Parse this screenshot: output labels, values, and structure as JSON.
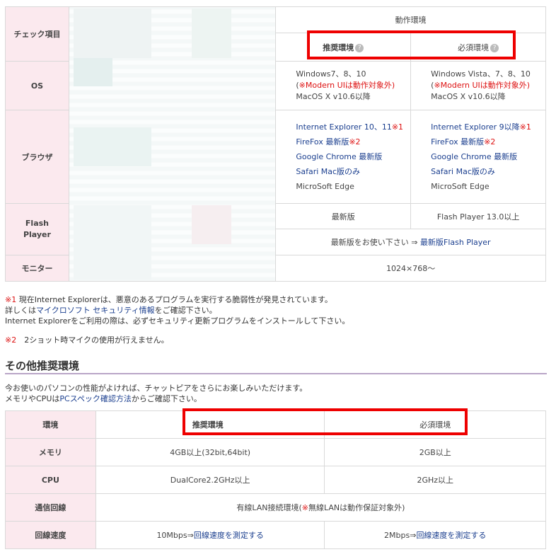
{
  "table1": {
    "header": {
      "check_item": "チェック項目",
      "env": "動作環境",
      "recommended": "推奨環境",
      "required": "必須環境",
      "help": "?"
    },
    "os": {
      "label": "OS",
      "rec": [
        "Windows7、8、10",
        "※Modern UIは動作対象外)",
        "MacOS X v10.6以降"
      ],
      "req": [
        "Windows Vista、7、8、10",
        "※Modern UIは動作対象外)",
        "MacOS X v10.6以降"
      ]
    },
    "browser": {
      "label": "ブラウザ",
      "rec": [
        {
          "text": "Internet Explorer 10、11",
          "mark": "※1"
        },
        {
          "text": "FireFox 最新版",
          "mark": "※2"
        },
        {
          "text": "Google Chrome 最新版",
          "mark": ""
        },
        {
          "text": "Safari Mac版のみ",
          "mark": ""
        },
        {
          "text": "MicroSoft Edge",
          "mark": ""
        }
      ],
      "req": [
        {
          "text": "Internet Explorer 9以降",
          "mark": "※1"
        },
        {
          "text": "FireFox 最新版",
          "mark": "※2"
        },
        {
          "text": "Google Chrome 最新版",
          "mark": ""
        },
        {
          "text": "Safari Mac版のみ",
          "mark": ""
        },
        {
          "text": "MicroSoft Edge",
          "mark": ""
        }
      ]
    },
    "flash": {
      "label_1": "Flash",
      "label_2": "Player",
      "rec": "最新版",
      "req": "Flash Player 13.0以上",
      "note_prefix": "最新版をお使い下さい ⇒ ",
      "note_link": "最新版Flash Player"
    },
    "monitor": {
      "label": "モニター",
      "value": "1024×768〜"
    }
  },
  "notes": {
    "n1_mark": "※1",
    "n1_line1": " 現在Internet Explorerは、悪意のあるプログラムを実行する脆弱性が発見されています。",
    "n1_line2_prefix": "詳しくは",
    "n1_line2_link": "マイクロソフト セキュリティ情報",
    "n1_line2_suffix": "をご確認下さい。",
    "n1_line3": "Internet Explorerをご利用の際は、必ずセキュリティ更新プログラムをインストールして下さい。",
    "n2_mark": "※2",
    "n2_text": "　2ショット時マイクの使用が行えません。"
  },
  "section2": {
    "title": "その他推奨環境",
    "desc1": "今お使いのパソコンの性能がよければ、チャットピアをさらにお楽しみいただけます。",
    "desc2_prefix": "メモリやCPUは",
    "desc2_link": "PCスペック確認方法",
    "desc2_suffix": "からご確認下さい。"
  },
  "table2": {
    "env_label": "環境",
    "recommended": "推奨環境",
    "required": "必須環境",
    "memory": {
      "label": "メモリ",
      "rec": "4GB以上(32bit,64bit)",
      "req": "2GB以上"
    },
    "cpu": {
      "label": "CPU",
      "rec": "DualCore2.2GHz以上",
      "req": "2GHz以上"
    },
    "line": {
      "label": "通信回線",
      "prefix": "有線LAN接続環境(",
      "mark": "※",
      "text": "無線LANは動作保証対象外)"
    },
    "speed": {
      "label": "回線速度",
      "rec_prefix": "10Mbps⇒",
      "rec_link": "回線速度を測定する",
      "req_prefix": "2Mbps⇒",
      "req_link": "回線速度を測定する"
    }
  },
  "colors": {
    "header_bg": "#fbe9ee",
    "highlight": "#e00000",
    "link": "#1b3f8f",
    "note_red": "#dd1111"
  }
}
